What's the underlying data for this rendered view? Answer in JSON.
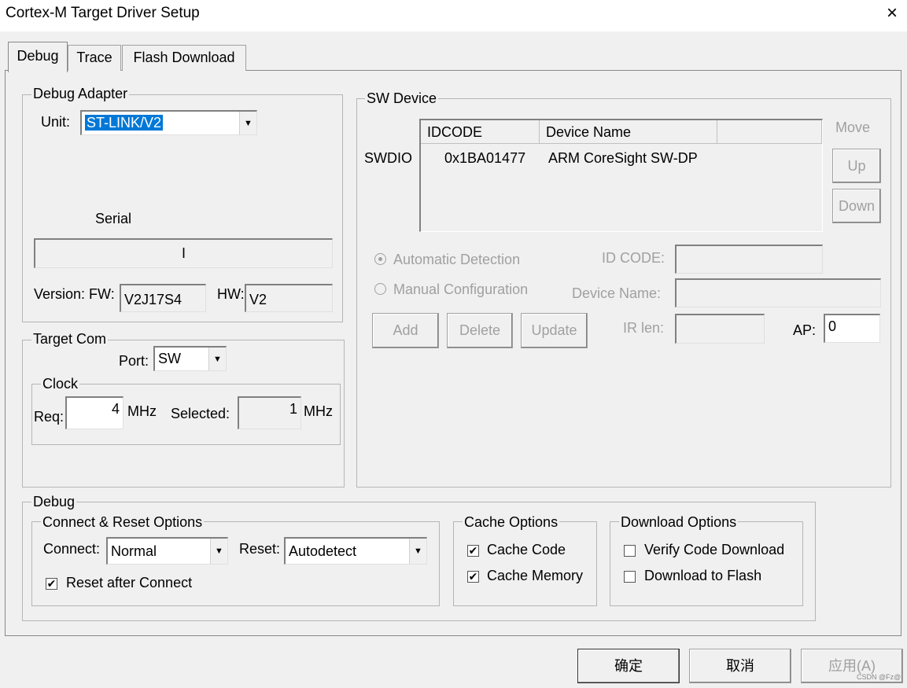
{
  "window": {
    "title": "Cortex-M Target Driver Setup",
    "close_icon": "×"
  },
  "tabs": [
    {
      "label": "Debug",
      "active": true
    },
    {
      "label": "Trace",
      "active": false
    },
    {
      "label": "Flash Download",
      "active": false
    }
  ],
  "debug_adapter": {
    "group_label": "Debug Adapter",
    "unit_label": "Unit:",
    "unit_value": "ST-LINK/V2",
    "serial_label": "Serial",
    "serial_value": "I",
    "version_label": "Version: FW:",
    "fw_value": "V2J17S4",
    "hw_label": "HW:",
    "hw_value": "V2"
  },
  "target_com": {
    "group_label": "Target Com",
    "port_label": "Port:",
    "port_value": "SW",
    "clock_label": "Clock",
    "req_label": "Req:",
    "req_value": "4",
    "req_unit": "MHz",
    "selected_label": "Selected:",
    "selected_value": "1",
    "selected_unit": "MHz"
  },
  "sw_device": {
    "group_label": "SW Device",
    "row_label": "SWDIO",
    "columns": [
      "IDCODE",
      "Device Name",
      ""
    ],
    "rows": [
      {
        "idcode": "0x1BA01477",
        "device_name": "ARM CoreSight SW-DP"
      }
    ],
    "move_label": "Move",
    "up_label": "Up",
    "down_label": "Down",
    "auto_detect_label": "Automatic Detection",
    "manual_config_label": "Manual Configuration",
    "id_code_label": "ID CODE:",
    "device_name_label": "Device Name:",
    "add_label": "Add",
    "delete_label": "Delete",
    "update_label": "Update",
    "ir_len_label": "IR len:",
    "ap_label": "AP:",
    "ap_value": "0"
  },
  "debug": {
    "group_label": "Debug",
    "connect_reset": {
      "group_label": "Connect & Reset Options",
      "connect_label": "Connect:",
      "connect_value": "Normal",
      "reset_label": "Reset:",
      "reset_value": "Autodetect",
      "reset_after_connect_label": "Reset after Connect",
      "reset_after_connect_checked": true
    },
    "cache": {
      "group_label": "Cache Options",
      "cache_code_label": "Cache Code",
      "cache_code_checked": true,
      "cache_memory_label": "Cache Memory",
      "cache_memory_checked": true
    },
    "download": {
      "group_label": "Download Options",
      "verify_label": "Verify Code Download",
      "verify_checked": false,
      "to_flash_label": "Download to Flash",
      "to_flash_checked": false
    }
  },
  "footer": {
    "ok_label": "确定",
    "cancel_label": "取消",
    "apply_label": "应用(A)",
    "watermark": "CSDN @Fz@"
  },
  "icons": {
    "check_mark": "✔",
    "dropdown_arrow": "▼"
  },
  "colors": {
    "selection": "#0078d7",
    "disabled_text": "#a0a0a0",
    "window_bg": "#f0f0f0"
  }
}
